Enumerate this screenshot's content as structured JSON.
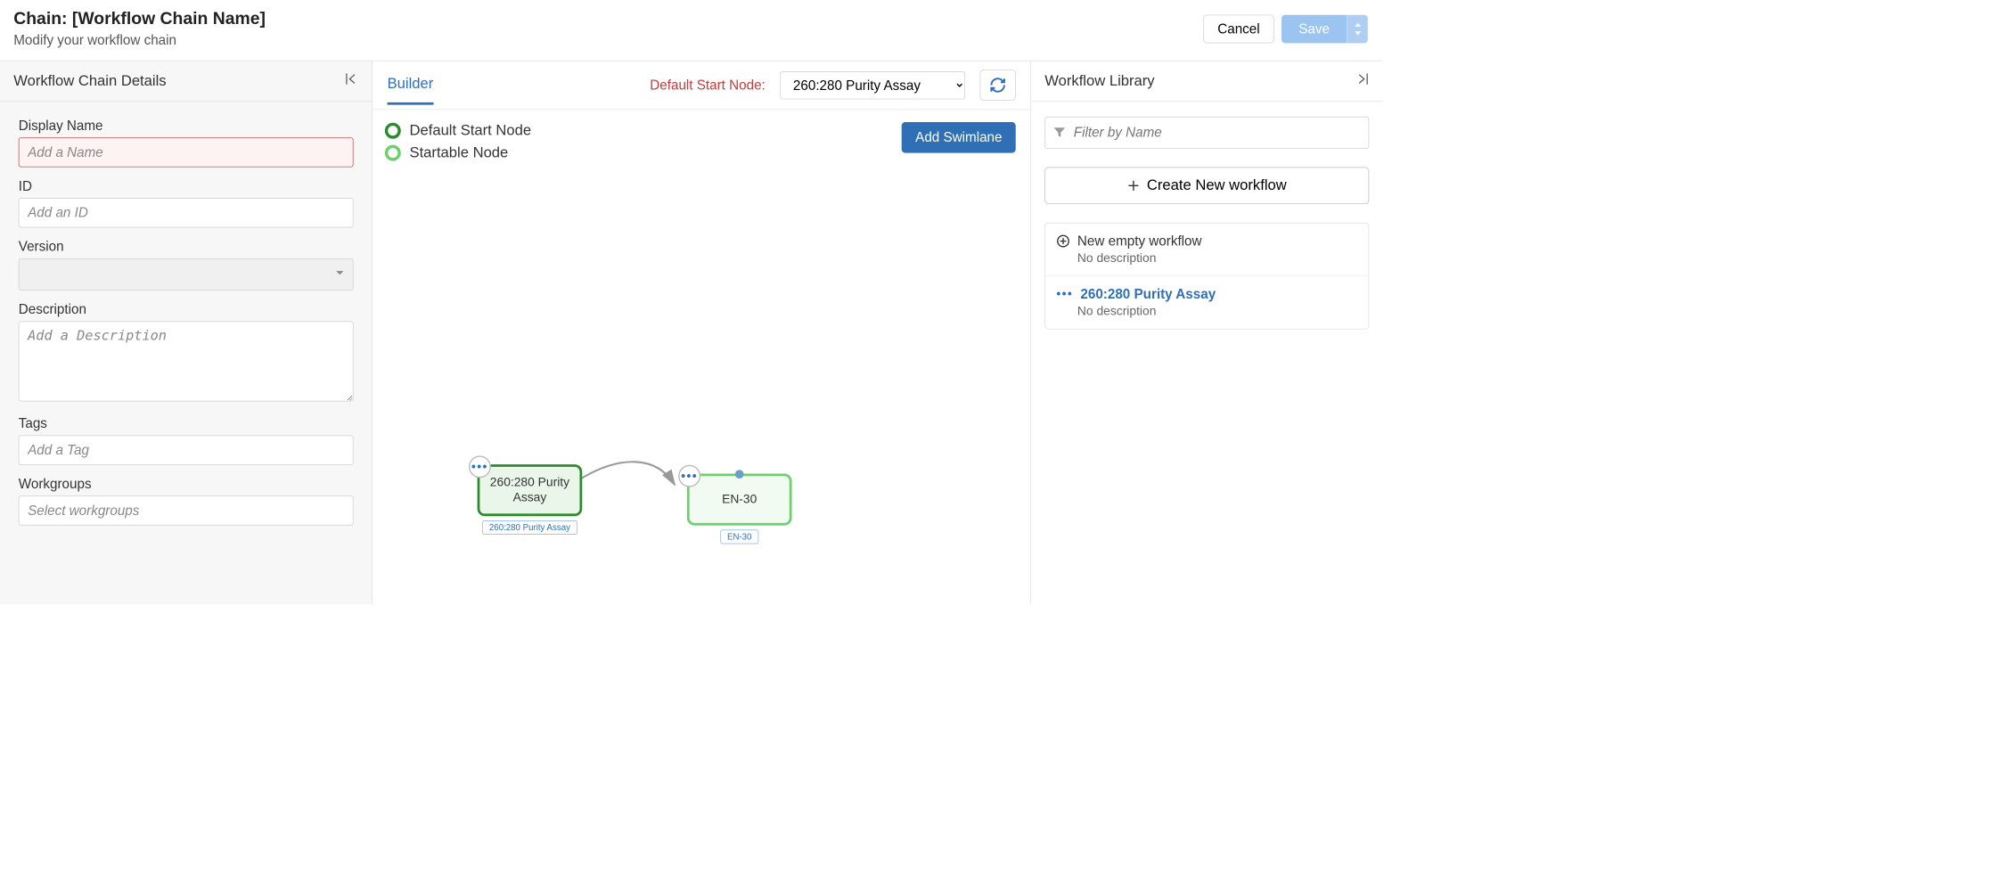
{
  "header": {
    "title": "Chain: [Workflow Chain Name]",
    "subtitle": "Modify your workflow chain",
    "cancel_label": "Cancel",
    "save_label": "Save"
  },
  "left": {
    "panel_title": "Workflow Chain Details",
    "fields": {
      "display_name_label": "Display Name",
      "display_name_placeholder": "Add a Name",
      "id_label": "ID",
      "id_placeholder": "Add an ID",
      "version_label": "Version",
      "description_label": "Description",
      "description_placeholder": "Add a Description",
      "tags_label": "Tags",
      "tags_placeholder": "Add a Tag",
      "workgroups_label": "Workgroups",
      "workgroups_placeholder": "Select workgroups"
    }
  },
  "center": {
    "tab_builder": "Builder",
    "default_start_label": "Default Start Node:",
    "default_start_value": "260:280 Purity Assay",
    "legend_default": "Default Start Node",
    "legend_startable": "Startable Node",
    "add_swimlane_label": "Add Swimlane",
    "nodes": {
      "node1": {
        "label": "260:280 Purity Assay",
        "tag": "260:280 Purity Assay"
      },
      "node2": {
        "label": "EN-30",
        "tag": "EN-30"
      }
    }
  },
  "right": {
    "panel_title": "Workflow Library",
    "filter_placeholder": "Filter by Name",
    "create_label": "Create New workflow",
    "items": [
      {
        "title": "New empty workflow",
        "desc": "No description"
      },
      {
        "title": "260:280 Purity Assay",
        "desc": "No description"
      }
    ]
  }
}
